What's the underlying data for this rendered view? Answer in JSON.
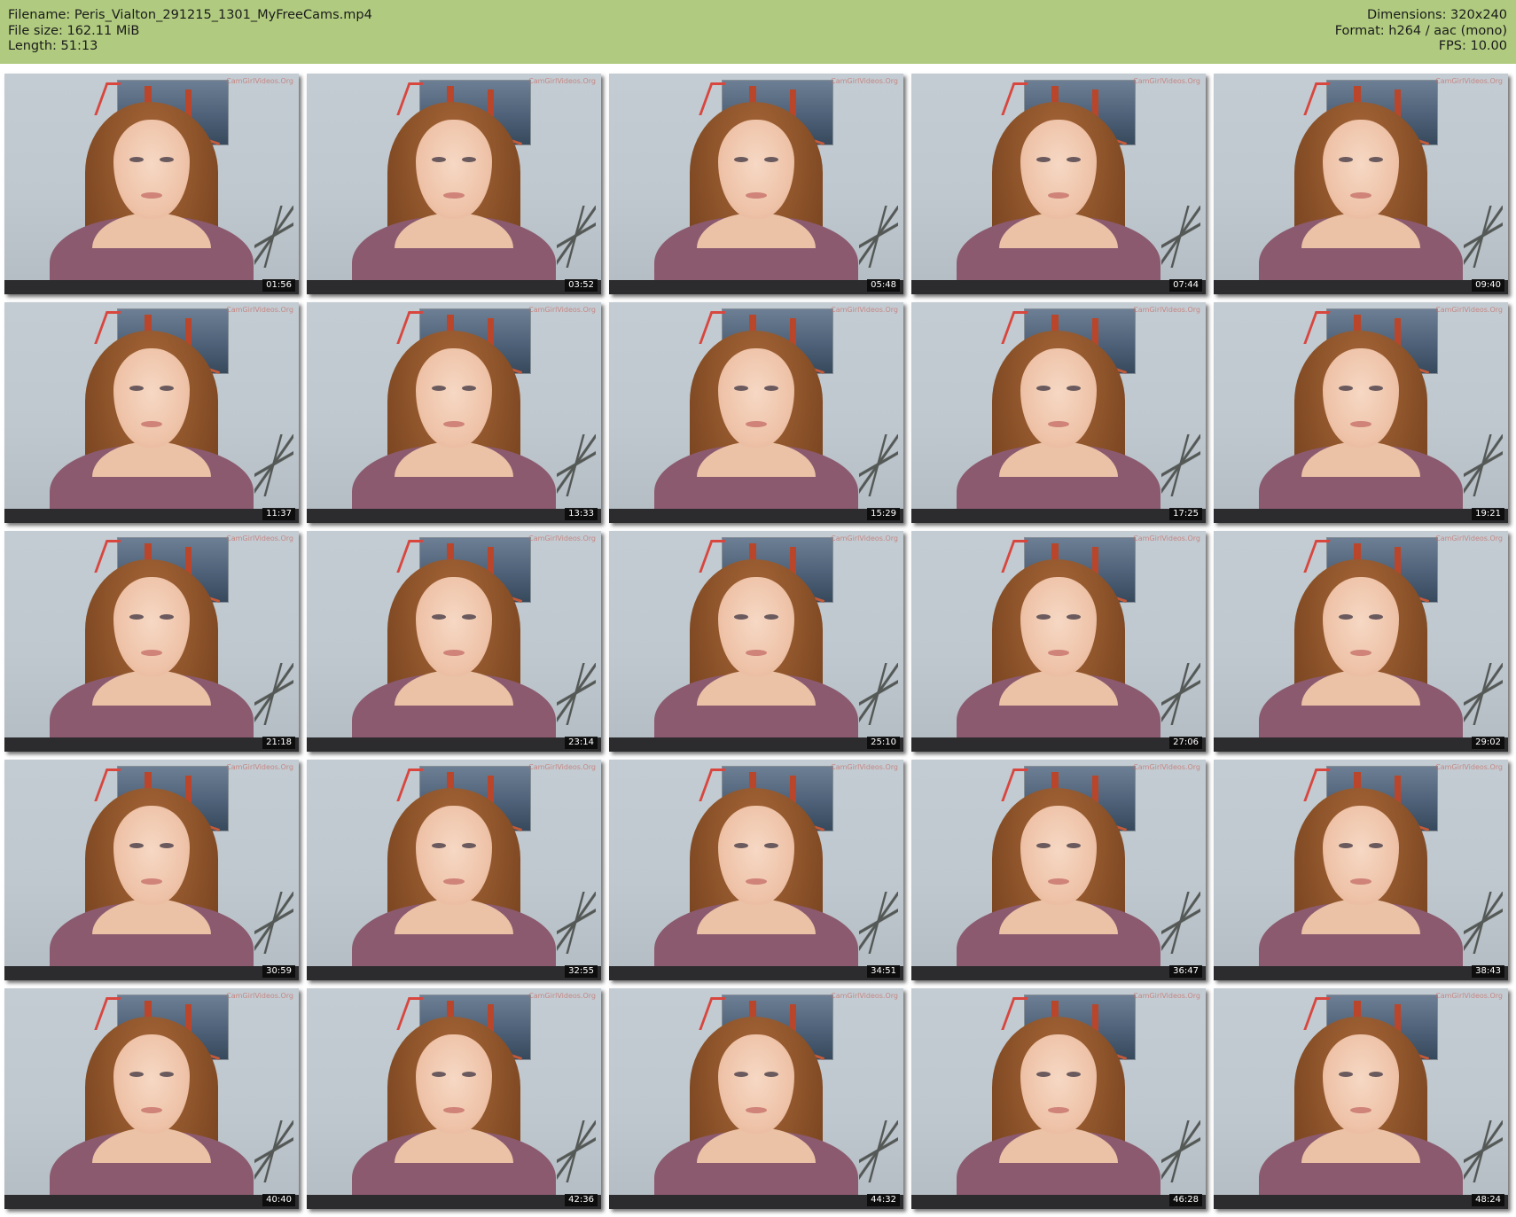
{
  "header": {
    "filename_line": "Filename: Peris_Vialton_291215_1301_MyFreeCams.mp4",
    "filesize_line": "File size: 162.11 MiB",
    "length_line": "Length: 51:13",
    "dimensions_line": "Dimensions: 320x240",
    "format_line": "Format: h264 / aac (mono)",
    "fps_line": "FPS: 10.00",
    "background_color": "#b0cb7f"
  },
  "thumbnails": [
    {
      "timestamp": "01:56"
    },
    {
      "timestamp": "03:52"
    },
    {
      "timestamp": "05:48"
    },
    {
      "timestamp": "07:44"
    },
    {
      "timestamp": "09:40"
    },
    {
      "timestamp": "11:37"
    },
    {
      "timestamp": "13:33"
    },
    {
      "timestamp": "15:29"
    },
    {
      "timestamp": "17:25"
    },
    {
      "timestamp": "19:21"
    },
    {
      "timestamp": "21:18"
    },
    {
      "timestamp": "23:14"
    },
    {
      "timestamp": "25:10"
    },
    {
      "timestamp": "27:06"
    },
    {
      "timestamp": "29:02"
    },
    {
      "timestamp": "30:59"
    },
    {
      "timestamp": "32:55"
    },
    {
      "timestamp": "34:51"
    },
    {
      "timestamp": "36:47"
    },
    {
      "timestamp": "38:43"
    },
    {
      "timestamp": "40:40"
    },
    {
      "timestamp": "42:36"
    },
    {
      "timestamp": "44:32"
    },
    {
      "timestamp": "46:28"
    },
    {
      "timestamp": "48:24"
    }
  ],
  "watermark_text": "CamGirlVideos.Org"
}
